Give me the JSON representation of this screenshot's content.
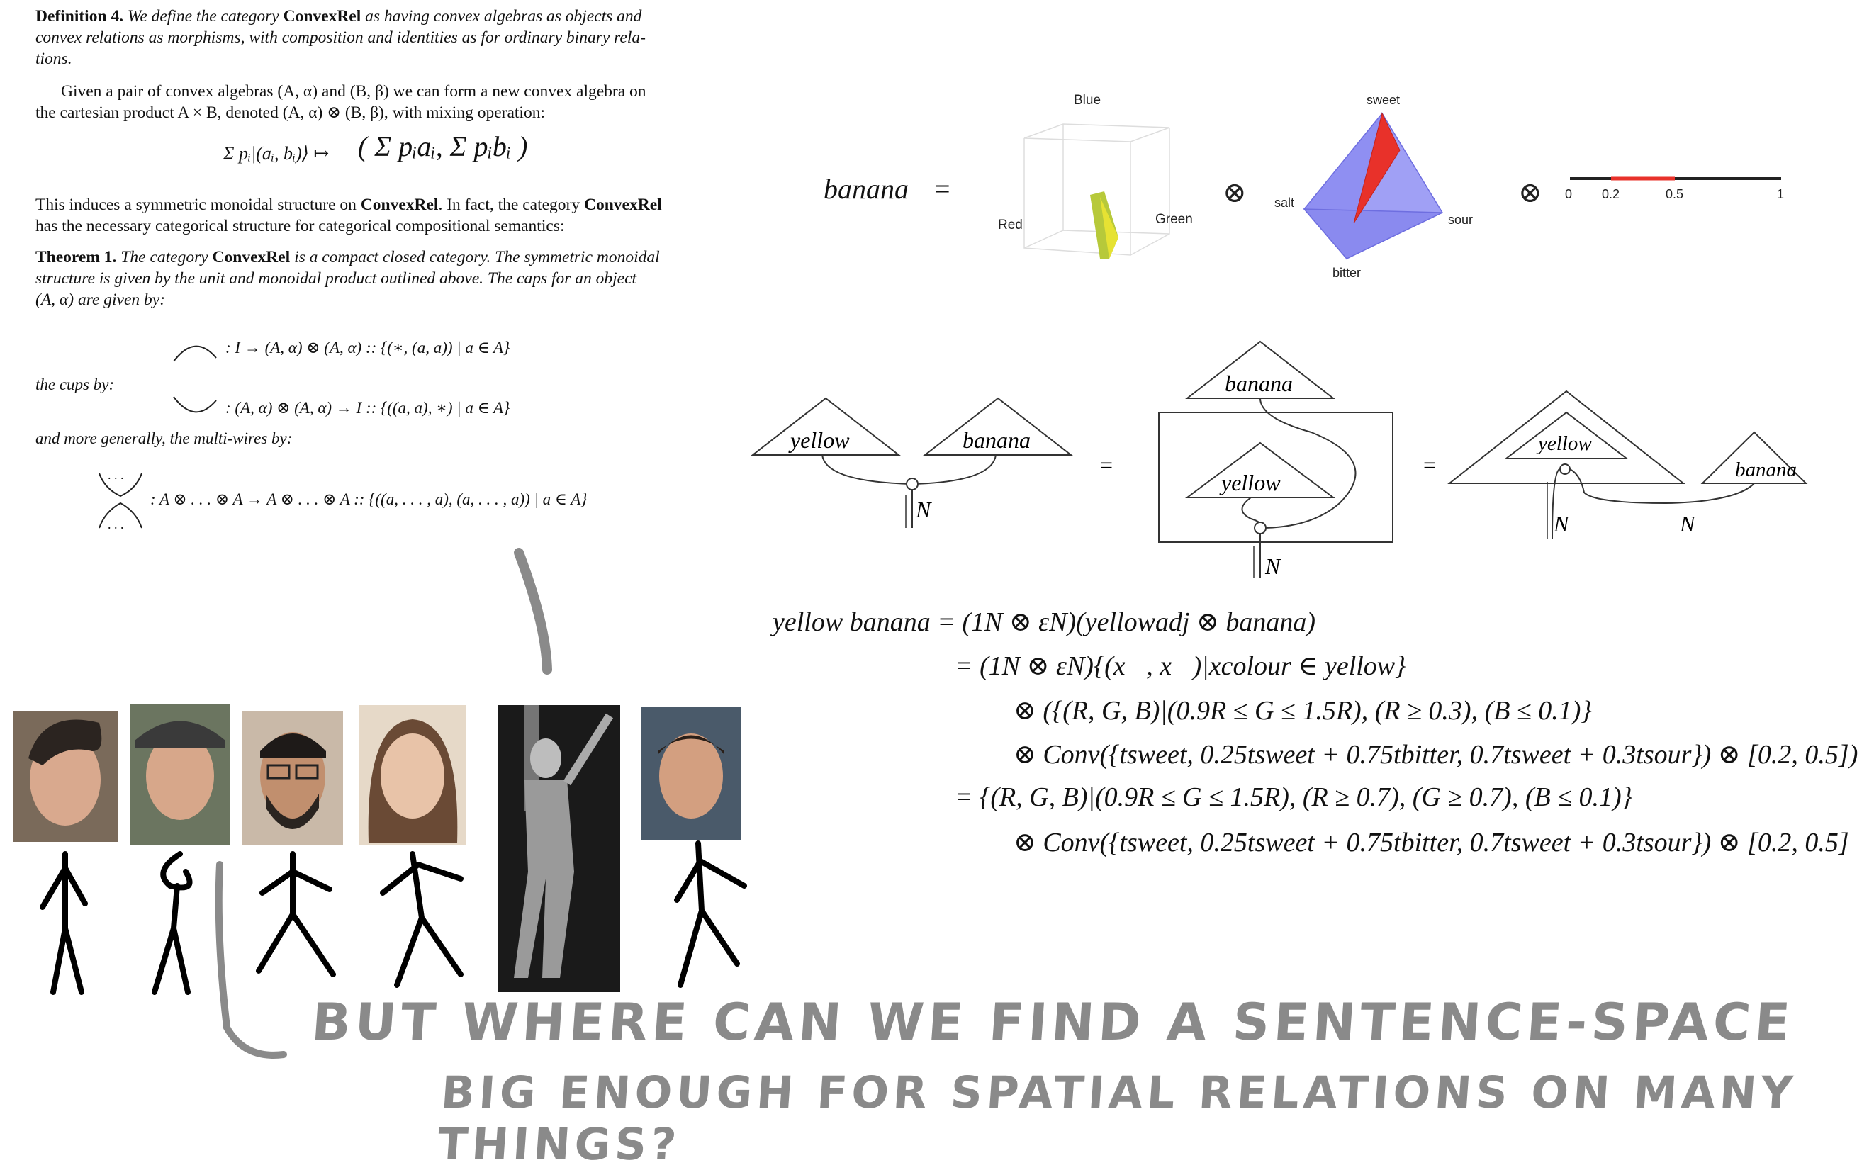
{
  "paper": {
    "def_head": "Definition 4.",
    "def_body_1": "We define the category",
    "def_cat": "ConvexRel",
    "def_body_2": "as having convex algebras as objects and",
    "def_line2": "convex relations as morphisms, with composition and identities as for ordinary binary rela-",
    "def_line3": "tions.",
    "para1_line1": "Given a pair of convex algebras (A, α) and (B, β) we can form a new convex algebra on",
    "para1_line2": "the cartesian product A × B, denoted (A, α) ⊗ (B, β), with mixing operation:",
    "mix_formula_lhs": "Σ pᵢ|(aᵢ, bᵢ)⟩ ↦",
    "mix_formula_rhs": "( Σ pᵢaᵢ, Σ pᵢbᵢ )",
    "mix_sub": "i",
    "para2_line1_a": "This induces a symmetric monoidal structure on",
    "para2_line1_b": "ConvexRel",
    "para2_line1_c": ". In fact, the category",
    "para2_line1_d": "ConvexRel",
    "para2_line2": "has the necessary categorical structure for categorical compositional semantics:",
    "thm_head": "Theorem 1.",
    "thm_line1_a": "The category",
    "thm_line1_b": "ConvexRel",
    "thm_line1_c": "is a compact closed category. The symmetric monoidal",
    "thm_line2": "structure is given by the unit and monoidal product outlined above. The caps for an object",
    "thm_line3": "(A, α) are given by:",
    "caps_formula": ": I → (A, α) ⊗ (A, α) :: {(∗, (a, a)) | a ∈ A}",
    "cups_label": "the cups by:",
    "cups_formula": ": (A, α) ⊗ (A, α) → I :: {((a, a), ∗) | a ∈ A}",
    "multi_label": "and more generally, the multi-wires by:",
    "multi_formula": ": A ⊗ . . . ⊗ A → A ⊗ . . . ⊗ A :: {((a, . . . , a), (a, . . . , a)) | a ∈ A}",
    "dots": ". . ."
  },
  "banana_eq": {
    "lhs": "banana",
    "eq": "=",
    "otimes": "⊗",
    "cube_labels": {
      "blue": "Blue",
      "red": "Red",
      "green": "Green"
    },
    "tetra_labels": {
      "sweet": "sweet",
      "salt": "salt",
      "sour": "sour",
      "bitter": "bitter"
    },
    "scale_ticks": [
      "0",
      "0.2",
      "0.5",
      "1"
    ],
    "colors": {
      "tetra_fill": "#8f8ff2",
      "tetra_red": "#e8312a",
      "interval_red": "#e8312a",
      "yellow": "#e6e233",
      "green": "#8aa832"
    }
  },
  "diagram": {
    "yellow": "yellow",
    "banana": "banana",
    "N": "N",
    "eq": "="
  },
  "derivation": {
    "line1": "yellow banana = (1N ⊗ εN)(yellowadj ⊗ banana)",
    "line2": "= (1N ⊗ εN){(x⃗, x⃗)|xcolour ∈ yellow}",
    "line3": "⊗ ({(R, G, B)|(0.9R ≤ G ≤ 1.5R), (R ≥ 0.3), (B ≤ 0.1)}",
    "line4": "⊗ Conv({tsweet, 0.25tsweet + 0.75tbitter, 0.7tsweet + 0.3tsour}) ⊗ [0.2, 0.5])",
    "line5": "= {(R, G, B)|(0.9R ≤ G ≤ 1.5R), (R ≥ 0.7), (G ≥ 0.7), (B ≤ 0.1)}",
    "line6": "⊗ Conv({tsweet, 0.25tsweet + 0.75tbitter, 0.7tsweet + 0.3tsour}) ⊗ [0.2, 0.5]"
  },
  "people": {
    "count": 6
  },
  "handwriting": {
    "line1": "BUT WHERE CAN WE FIND A SENTENCE-SPACE",
    "line2": "BIG ENOUGH FOR SPATIAL RELATIONS ON MANY THINGS?",
    "color": "#8a8a8a"
  }
}
